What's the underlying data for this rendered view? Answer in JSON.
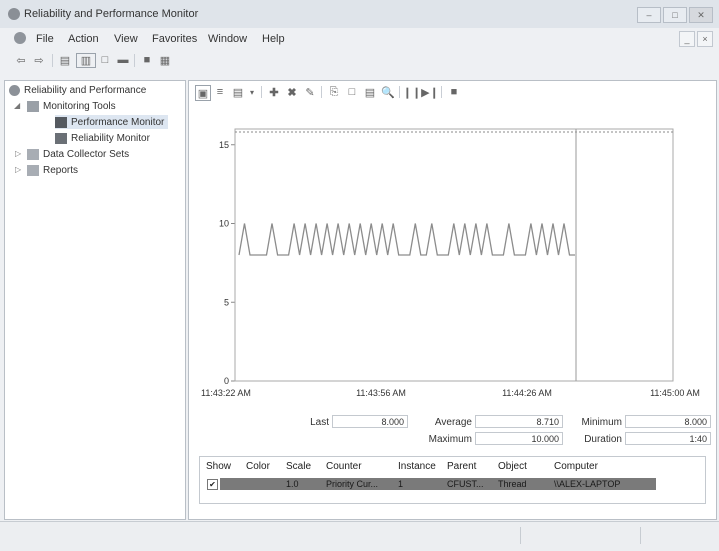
{
  "window": {
    "title": "Reliability and Performance Monitor",
    "controls": [
      "–",
      "□",
      "✕"
    ]
  },
  "menu": {
    "items": [
      "File",
      "Action",
      "View",
      "Favorites",
      "Window",
      "Help"
    ],
    "right_controls": [
      "_",
      "×"
    ]
  },
  "tree": {
    "root": "Reliability and Performance",
    "monitoring_tools": "Monitoring Tools",
    "performance_monitor": "Performance Monitor",
    "reliability_monitor": "Reliability Monitor",
    "data_collector_sets": "Data Collector Sets",
    "reports": "Reports"
  },
  "chart_data": {
    "type": "line",
    "x_ticks": [
      "11:43:22 AM",
      "11:43:56 AM",
      "11:44:26 AM",
      "11:45:00 AM"
    ],
    "y_ticks": [
      "0",
      "5",
      "10",
      "15"
    ],
    "ylim": [
      0,
      16
    ],
    "grid": false,
    "series": [
      {
        "color": "#8c8c8c",
        "values": [
          8,
          10,
          8,
          8,
          8,
          8,
          10,
          8,
          8,
          8,
          10,
          8,
          10,
          8,
          10,
          8,
          10,
          8,
          10,
          8,
          10,
          8,
          10,
          8,
          10,
          8,
          10,
          8,
          10,
          8,
          8,
          8,
          10,
          8,
          8,
          10,
          8,
          8,
          8,
          10,
          8,
          10,
          8,
          10,
          8,
          10,
          8,
          8,
          8,
          10,
          8,
          8,
          8,
          10,
          8,
          10,
          8,
          10,
          8,
          10,
          8,
          8
        ]
      }
    ]
  },
  "stats": {
    "last_label": "Last",
    "last_value": "8.000",
    "average_label": "Average",
    "average_value": "8.710",
    "minimum_label": "Minimum",
    "minimum_value": "8.000",
    "maximum_label": "Maximum",
    "maximum_value": "10.000",
    "duration_label": "Duration",
    "duration_value": "1:40"
  },
  "counters": {
    "columns": [
      "Show",
      "Color",
      "Scale",
      "Counter",
      "Instance",
      "Parent",
      "Object",
      "Computer"
    ],
    "rows": [
      {
        "show": "✔",
        "scale": "1.0",
        "counter": "Priority Cur...",
        "instance": "1",
        "parent": "CFUST...",
        "object": "Thread",
        "computer": "\\\\ALEX-LAPTOP"
      }
    ]
  }
}
